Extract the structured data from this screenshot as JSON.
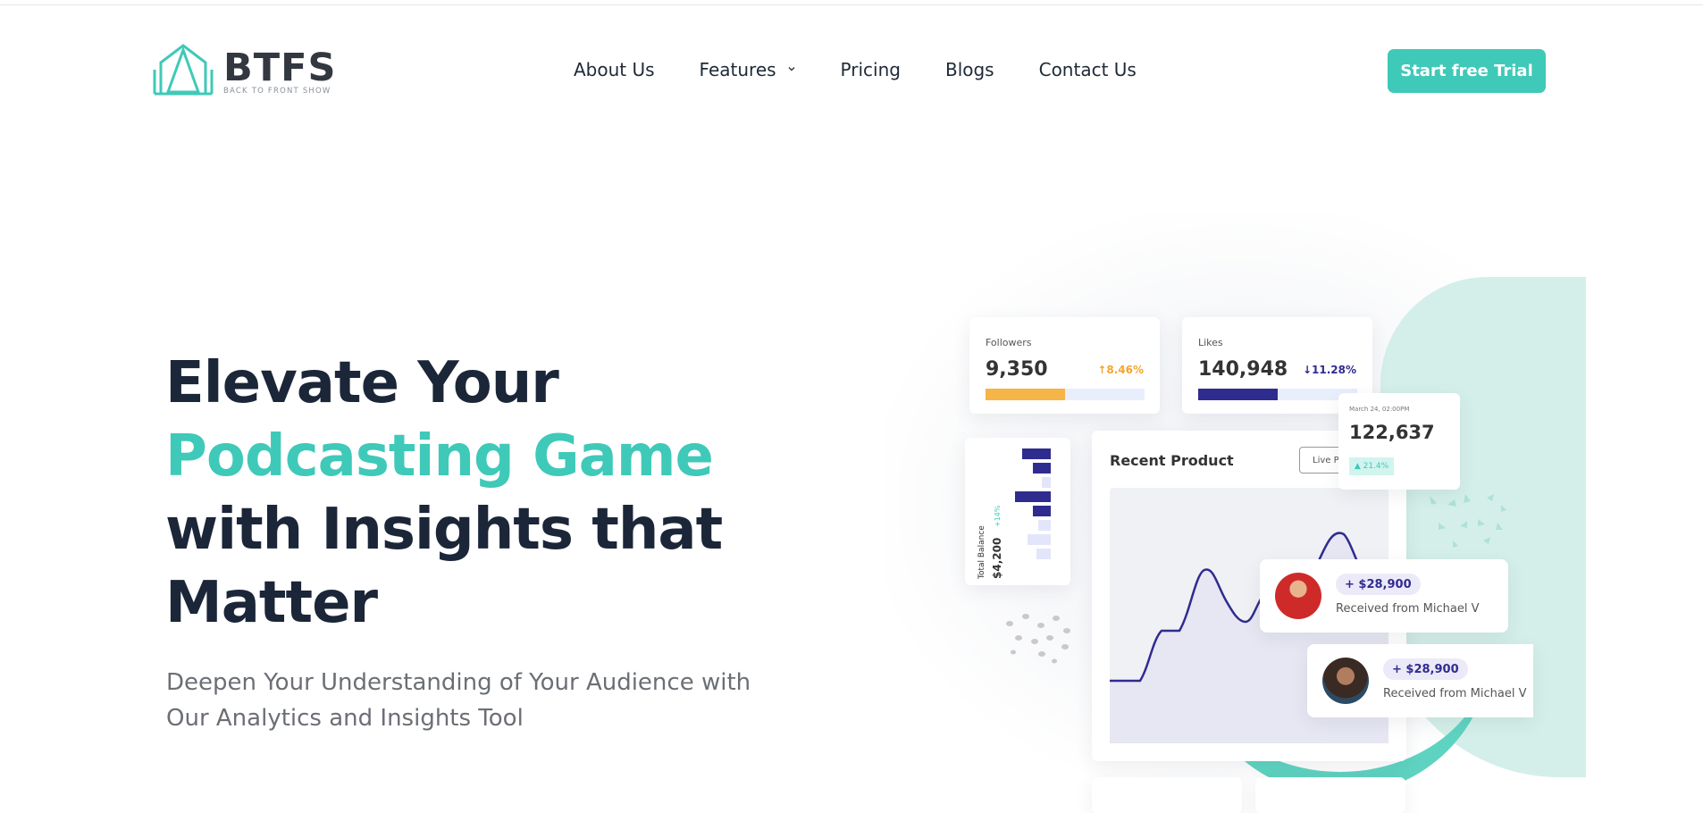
{
  "header": {
    "logo_name": "BTFS",
    "logo_tagline": "BACK TO FRONT SHOW",
    "nav": [
      {
        "label": "About Us"
      },
      {
        "label": "Features"
      },
      {
        "label": "Pricing"
      },
      {
        "label": "Blogs"
      },
      {
        "label": "Contact Us"
      }
    ],
    "cta_label": "Start free Trial"
  },
  "hero": {
    "title_line1": "Elevate Your",
    "title_line2": "Podcasting Game",
    "title_line3": "with Insights that",
    "title_line4": "Matter",
    "subtitle_line1": "Deepen Your Understanding of Your Audience with",
    "subtitle_line2": "Our Analytics and Insights Tool"
  },
  "illustration": {
    "followers": {
      "label": "Followers",
      "value": "9,350",
      "change": "↑8.46%",
      "fill": 0.5
    },
    "likes": {
      "label": "Likes",
      "value": "140,948",
      "change": "↓11.28%",
      "fill": 0.5
    },
    "mini_stat": {
      "date": "March 24, 02:00PM",
      "value": "122,637",
      "badge": "▲ 21.4%"
    },
    "balance": {
      "label": "Total Balance",
      "value": "$4,200",
      "change": "+14%"
    },
    "product": {
      "title": "Recent Product",
      "button": "Live Pr"
    },
    "payments": [
      {
        "amount": "+ $28,900",
        "desc": "Received from Michael V"
      },
      {
        "amount": "+ $28,900",
        "desc": "Received from Michael V"
      }
    ],
    "colors": {
      "accent": "#3fc9b8",
      "navy": "#1b2638",
      "indigo": "#2f2c8f",
      "orange": "#f5b548"
    }
  }
}
